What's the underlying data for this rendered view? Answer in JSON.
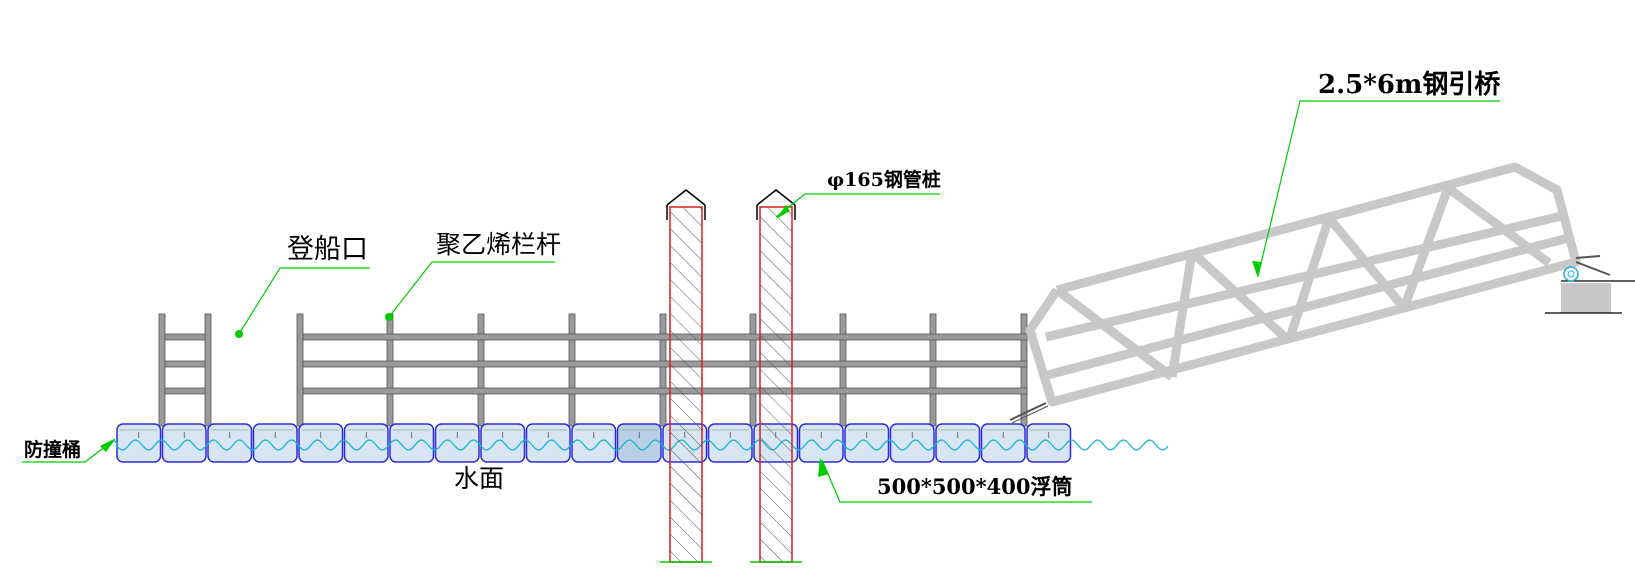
{
  "labels": {
    "boarding_gate": "登船口",
    "railing": "聚乙烯栏杆",
    "pile": "φ165钢管桩",
    "bridge": "2.5*6m钢引桥",
    "fender": "防撞桶",
    "water": "水面",
    "float": "500*500*400浮筒"
  },
  "colors": {
    "leader": "#00cc00",
    "railing": "#7a7a7a",
    "bridge": "#c8c8c8",
    "float_fill": "#d7e6f2",
    "float_edge": "#2b2bd6",
    "wave": "#18b4d8",
    "pile_edge": "#d42020",
    "hatch": "#555555"
  },
  "counts": {
    "floats": 21,
    "piles": 2
  }
}
